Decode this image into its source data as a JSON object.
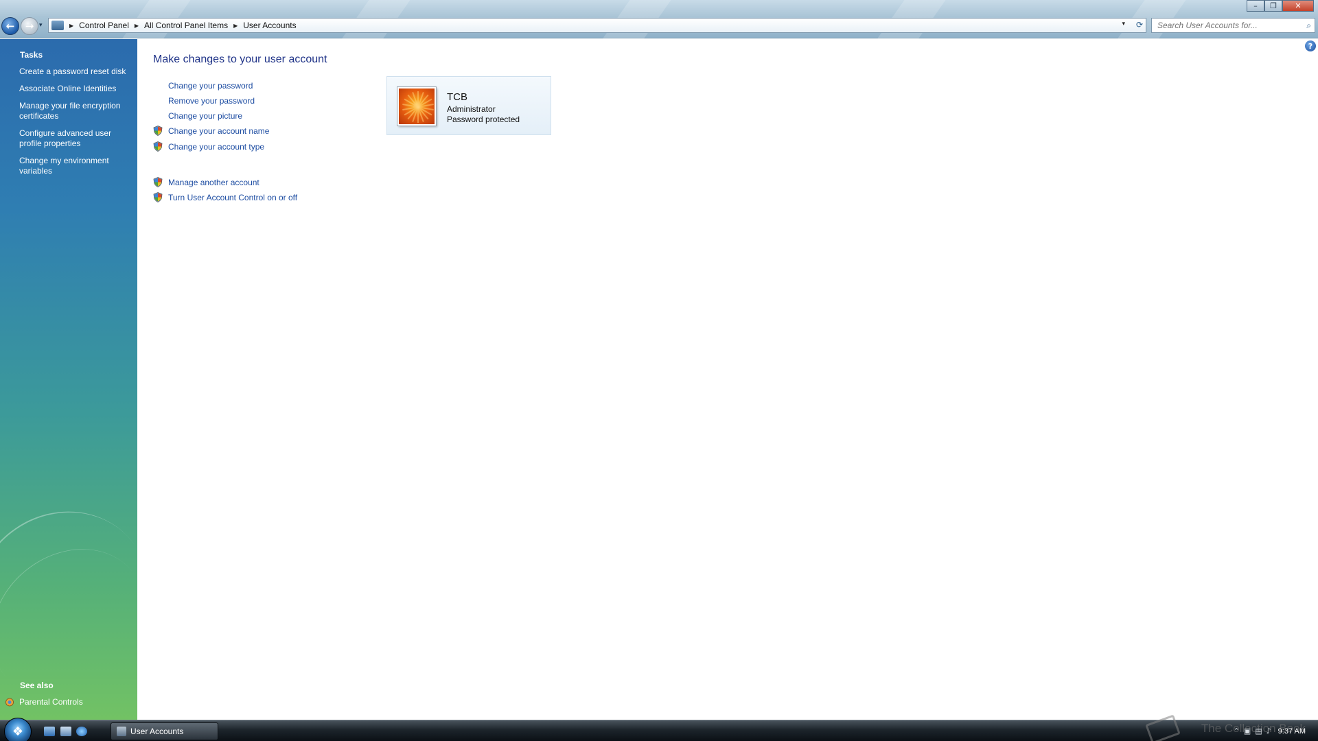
{
  "window": {
    "minimize_label": "–",
    "maximize_label": "❐",
    "close_label": "✕"
  },
  "nav": {
    "back_glyph": "←",
    "forward_glyph": "→",
    "recent_glyph": "▾"
  },
  "address": {
    "crumbs": [
      "Control Panel",
      "All Control Panel Items",
      "User Accounts"
    ],
    "separator": "▶",
    "dropdown_glyph": "▾",
    "refresh_glyph": "⟳"
  },
  "search": {
    "placeholder": "Search User Accounts for...",
    "icon_glyph": "⌕"
  },
  "leftpane": {
    "tasks_heading": "Tasks",
    "links": [
      "Create a password reset disk",
      "Associate Online Identities",
      "Manage your file encryption certificates",
      "Configure advanced user profile properties",
      "Change my environment variables"
    ],
    "see_also_heading": "See also",
    "see_also_links": [
      "Parental Controls"
    ]
  },
  "main": {
    "title": "Make changes to your user account",
    "tasks": [
      {
        "label": "Change your password",
        "shield": false
      },
      {
        "label": "Remove your password",
        "shield": false
      },
      {
        "label": "Change your picture",
        "shield": false
      },
      {
        "label": "Change your account name",
        "shield": true
      },
      {
        "label": "Change your account type",
        "shield": true
      }
    ],
    "other_tasks": [
      {
        "label": "Manage another account",
        "shield": true
      },
      {
        "label": "Turn User Account Control on or off",
        "shield": true
      }
    ],
    "help_glyph": "?"
  },
  "account": {
    "name": "TCB",
    "role": "Administrator",
    "status": "Password protected"
  },
  "taskbar": {
    "task_button_label": "User Accounts",
    "clock": "9:37 AM",
    "watermark": "The Collection Book",
    "tray_glyphs": [
      "⌃",
      "▣",
      "▤",
      "♪"
    ]
  },
  "colors": {
    "link": "#1b4ba1",
    "title": "#1e3287",
    "leftpane_top": "#2b6bad",
    "leftpane_bottom": "#72c264"
  }
}
